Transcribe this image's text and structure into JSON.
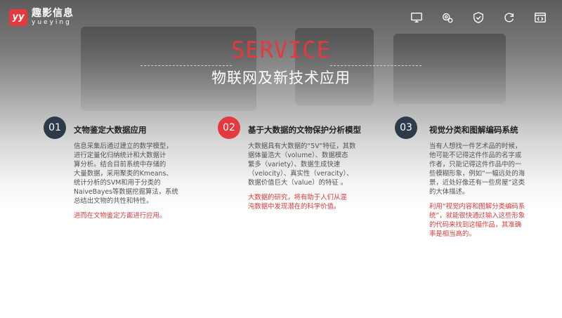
{
  "brand": {
    "name_cn": "趣影信息",
    "name_en": "yueying"
  },
  "toolbar": [
    {
      "icon": "monitor-icon"
    },
    {
      "icon": "gears-icon"
    },
    {
      "icon": "shield-check-icon"
    },
    {
      "icon": "refresh-icon"
    },
    {
      "icon": "code-window-icon"
    }
  ],
  "title": {
    "en": "SERVICE",
    "cn": "物联网及新技术应用"
  },
  "colors": {
    "accent": "#e5393f",
    "dark": "#2d3a4a"
  },
  "cards": [
    {
      "num": "01",
      "title": "文物鉴定大数据应用",
      "body": "信息采集后通过建立的数学模型，\n进行定量化归纳统计和大数据计\n算分析。结合目前系统中存储的\n大量数据，采用聚类的Kmeans、\n统计分析的SVM和用于分类的\nNaiveBayes等数据挖掘算法，系统\n总结出文物的共性和特性。",
      "highlight": "进而在文物鉴定方面进行应用。"
    },
    {
      "num": "02",
      "title": "基于大数据的文物保护分析模型",
      "body": "大数据具有大数据的“5V”特征，其数\n据体量浩大（volume）、数据模态\n繁多（variety）、数据生成快速\n（velocity）、真实性（veracity）、\n数据价值巨大（value）的特征 。",
      "highlight": "大数据的研究，将有助于人们从混\n沌数据中发现潜在的科学价值。"
    },
    {
      "num": "03",
      "title": "视觉分类和图解编码系统",
      "body": "当有人想找一件艺术品的时候，\n他可能不记得这件作品的名字或\n作者，只能记得这件作品中的一\n些模糊形象，例如“一幅远处的海\n景，近处好像还有一些房屋”这类\n的大体描述。",
      "highlight": "利用“视觉内容和图解分类编码系\n统”，就能很快通过输入这些形象\n的代码来找到这幅作品，其准确\n率是相当高的。"
    }
  ]
}
